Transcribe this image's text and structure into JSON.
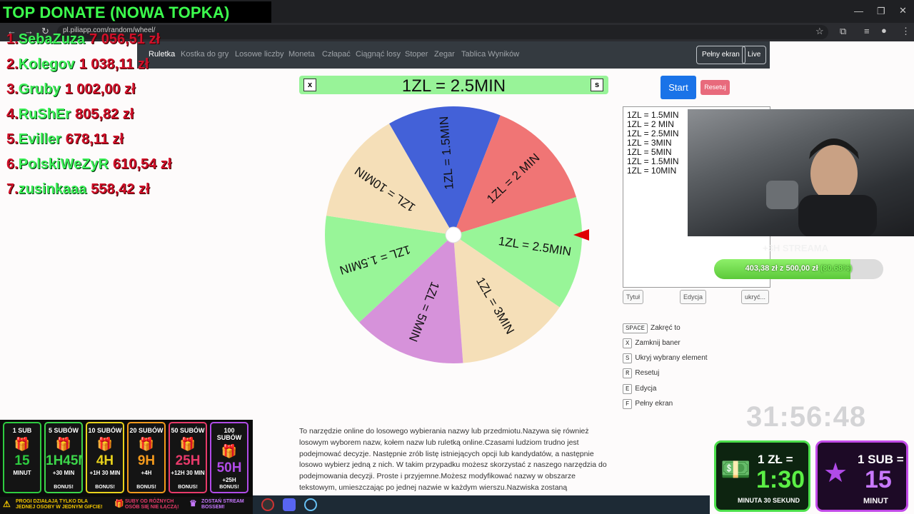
{
  "browser": {
    "url": "pl.piliapp.com/random/wheel/"
  },
  "nav": {
    "links": [
      "Ruletka",
      "Kostka do gry",
      "Losowe liczby",
      "Moneta",
      "Człapać",
      "Ciągnąć losy",
      "Stoper",
      "Zegar",
      "Tablica Wyników"
    ],
    "fullscreen": "Pełny ekran",
    "live": "Live"
  },
  "banner": {
    "text": "1ZL = 2.5MIN",
    "close_key": "x",
    "hide_key": "s"
  },
  "wheel": {
    "segments": [
      {
        "label": "1ZL = 1.5MIN",
        "color": "#4361d8"
      },
      {
        "label": "1ZL = 2 MIN",
        "color": "#f07575"
      },
      {
        "label": "1ZL = 2.5MIN",
        "color": "#98f598"
      },
      {
        "label": "1ZL = 3MIN",
        "color": "#f5dfb8"
      },
      {
        "label": "1ZL = 5MIN",
        "color": "#d692da"
      },
      {
        "label": "1ZL = 1.5MIN",
        "color": "#98f598"
      },
      {
        "label": "1ZL = 10MIN",
        "color": "#f5dfb8"
      }
    ],
    "pointer_color": "#e00000"
  },
  "controls": {
    "start": "Start",
    "reset": "Resetuj",
    "title_btn": "Tytuł",
    "edit_btn": "Edycja",
    "hide_btn": "ukryć..."
  },
  "names": [
    "1ZL = 1.5MIN",
    "1ZL = 2 MIN",
    "1ZL = 2.5MIN",
    "1ZL = 3MIN",
    "1ZL = 5MIN",
    "1ZL = 1.5MIN",
    "1ZL = 10MIN"
  ],
  "shortcuts": [
    {
      "key": "SPACE",
      "label": "Zakręć to"
    },
    {
      "key": "X",
      "label": "Zamknij baner"
    },
    {
      "key": "S",
      "label": "Ukryj wybrany element"
    },
    {
      "key": "R",
      "label": "Resetuj"
    },
    {
      "key": "E",
      "label": "Edycja"
    },
    {
      "key": "F",
      "label": "Pełny ekran"
    }
  ],
  "description": "To narzędzie online do losowego wybierania nazwy lub przedmiotu.Nazywa się również losowym wyborem nazw, kołem nazw lub ruletką online.Czasami ludziom trudno jest podejmować decyzje. Następnie zrób listę istniejących opcji lub kandydatów, a następnie losowo wybierz jedną z nich. W takim przypadku możesz skorzystać z naszego narzędzia do podejmowania decyzji. Proste i przyjemne.Możesz modyfikować nazwy w obszarze tekstowym, umieszczając po jednej nazwie w każdym wierszu.Nazwiska zostaną narysowane",
  "overlay": {
    "donate_title": "TOP DONATE (NOWA TOPKA)",
    "donors": [
      {
        "rank": "1.",
        "name": "SebaZuza",
        "amount": "7 056,51 zł"
      },
      {
        "rank": "2.",
        "name": "Kolegov",
        "amount": "1 038,11 zł"
      },
      {
        "rank": "3.",
        "name": "Gruby",
        "amount": "1 002,00 zł"
      },
      {
        "rank": "4.",
        "name": "RuShEr",
        "amount": "805,82 zł"
      },
      {
        "rank": "5.",
        "name": "Eviller",
        "amount": "678,11 zł"
      },
      {
        "rank": "6.",
        "name": "PolskiWeZyR",
        "amount": "610,54 zł"
      },
      {
        "rank": "7.",
        "name": "zusinkaaa",
        "amount": "558,42 zł"
      }
    ],
    "goal_label": "+3H STREAMA",
    "goal_text": "403,38 zł z 500,00 zł",
    "goal_pct": "(80.68%)",
    "goal_fraction": 0.8068,
    "timer": "31:56:48",
    "sub_tiers": [
      {
        "head": "1 SUB",
        "big": "15",
        "bonus": "MINUT",
        "foot": "",
        "color": "#2ecc40"
      },
      {
        "head": "5 SUBÓW",
        "big": "1H45MIN",
        "bonus": "+30 MIN",
        "foot": "BONUS!",
        "color": "#3cd64a"
      },
      {
        "head": "10 SUBÓW",
        "big": "4H",
        "bonus": "+1H 30 MIN",
        "foot": "BONUS!",
        "color": "#e8d21c"
      },
      {
        "head": "20 SUBÓW",
        "big": "9H",
        "bonus": "+4H",
        "foot": "BONUS!",
        "color": "#f39a1d"
      },
      {
        "head": "50 SUBÓW",
        "big": "25H",
        "bonus": "+12H 30 MIN",
        "foot": "BONUS!",
        "color": "#e83a6a"
      },
      {
        "head": "100 SUBÓW",
        "big": "50H",
        "bonus": "+25H",
        "foot": "BONUS!",
        "color": "#b14be8"
      }
    ],
    "sub_notes": [
      "PROGI DZIAŁAJĄ TYLKO DLA JEDNEJ OSOBY W JEDNYM GIFCIE!",
      "SUBY OD RÓŻNYCH OSÓB SIĘ NIE ŁĄCZĄ!",
      "ZOSTAŃ STREAM BOSSEM!"
    ],
    "rate_zl": {
      "head": "1 ZŁ =",
      "value": "1:30",
      "foot": "MINUTA 30 SEKUND"
    },
    "rate_sub": {
      "head": "1 SUB =",
      "value": "15",
      "foot": "MINUT"
    }
  }
}
